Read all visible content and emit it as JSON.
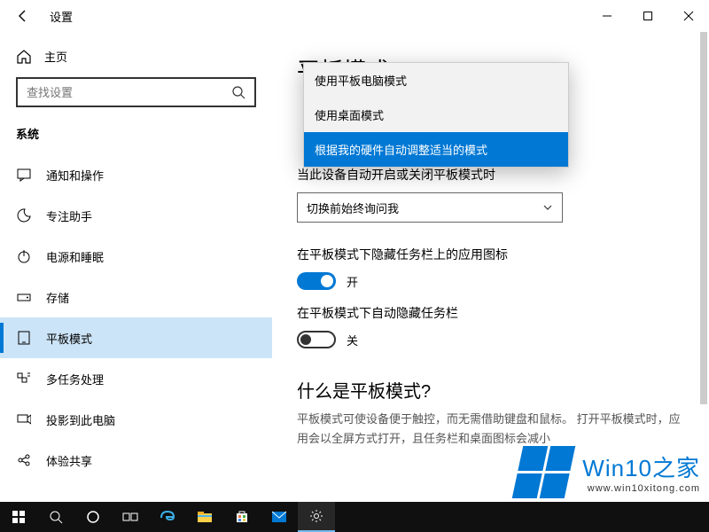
{
  "window": {
    "title": "设置"
  },
  "sidebar": {
    "home": "主页",
    "search_placeholder": "查找设置",
    "section": "系统",
    "items": [
      {
        "label": "通知和操作"
      },
      {
        "label": "专注助手"
      },
      {
        "label": "电源和睡眠"
      },
      {
        "label": "存储"
      },
      {
        "label": "平板模式"
      },
      {
        "label": "多任务处理"
      },
      {
        "label": "投影到此电脑"
      },
      {
        "label": "体验共享"
      }
    ]
  },
  "content": {
    "heading": "平板模式",
    "dropdown_open": {
      "options": [
        "使用平板电脑模式",
        "使用桌面模式",
        "根据我的硬件自动调整适当的模式"
      ]
    },
    "auto_switch": {
      "label": "当此设备自动开启或关闭平板模式时",
      "value": "切换前始终询问我"
    },
    "hide_icons": {
      "label": "在平板模式下隐藏任务栏上的应用图标",
      "state_text": "开",
      "on": true
    },
    "hide_taskbar": {
      "label": "在平板模式下自动隐藏任务栏",
      "state_text": "关",
      "on": false
    },
    "what_is": {
      "title": "什么是平板模式?",
      "desc": "平板模式可使设备便于触控，而无需借助键盘和鼠标。 打开平板模式时，应用会以全屏方式打开，且任务栏和桌面图标会减小"
    }
  },
  "watermark": {
    "brand": "Win10之家",
    "url": "www.win10xitong.com"
  }
}
